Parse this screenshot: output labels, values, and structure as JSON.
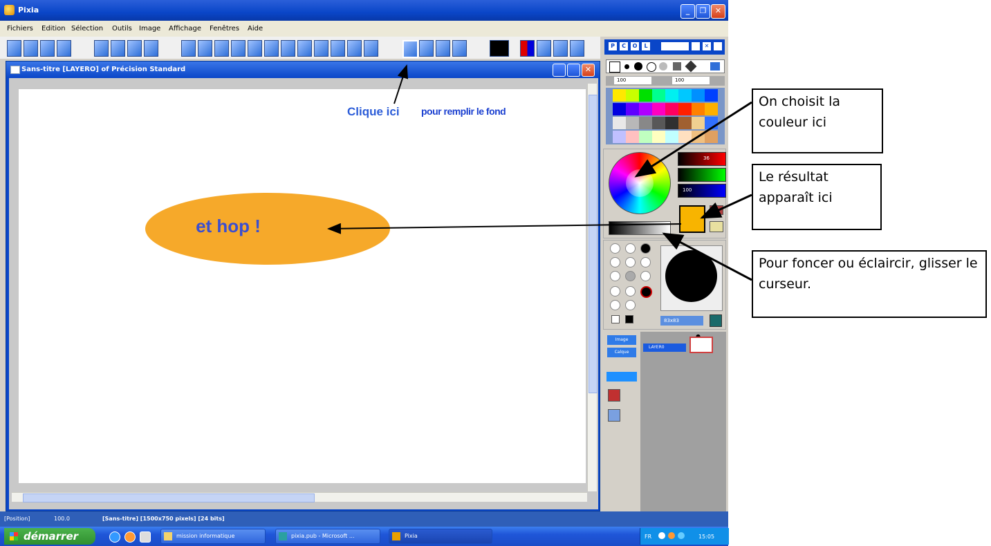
{
  "app": {
    "title": "Pixia"
  },
  "menu": {
    "items": [
      "Fichiers",
      "Edition",
      "Sélection",
      "Outils",
      "Image",
      "Affichage",
      "Fenêtres",
      "Aide"
    ]
  },
  "document": {
    "title": "Sans-titre [LAYERO] of Précision Standard"
  },
  "canvas": {
    "ellipse_text": "et hop !",
    "hint_click": "Clique ici",
    "hint_fill": "pour remplir le fond",
    "ellipse_color": "#f6a92a"
  },
  "palette": {
    "tabs": [
      "P",
      "C",
      "O",
      "L"
    ],
    "slider_values": [
      "100",
      "100"
    ],
    "rgb_values": [
      "36",
      "",
      "100"
    ],
    "brush_size": "83x83",
    "result_color": "#f8b400"
  },
  "layers": {
    "image_btn": "Image",
    "layer_btn": "Calque",
    "layer_name": "LAYER0"
  },
  "status": {
    "position": "[Position]",
    "zoom": "100.0",
    "info": "[Sans-titre] [1500x750 pixels] [24 bits]"
  },
  "taskbar": {
    "start": "démarrer",
    "tasks": [
      "mission informatique",
      "pixia.pub - Microsoft ...",
      "Pixia"
    ],
    "tray": {
      "lang": "FR",
      "time": "15:05"
    }
  },
  "callouts": {
    "color_choice": "On choisit la couleur ici",
    "result": "Le résultat apparaît ici",
    "slider": "Pour foncer ou éclaircir, glisser le curseur."
  }
}
